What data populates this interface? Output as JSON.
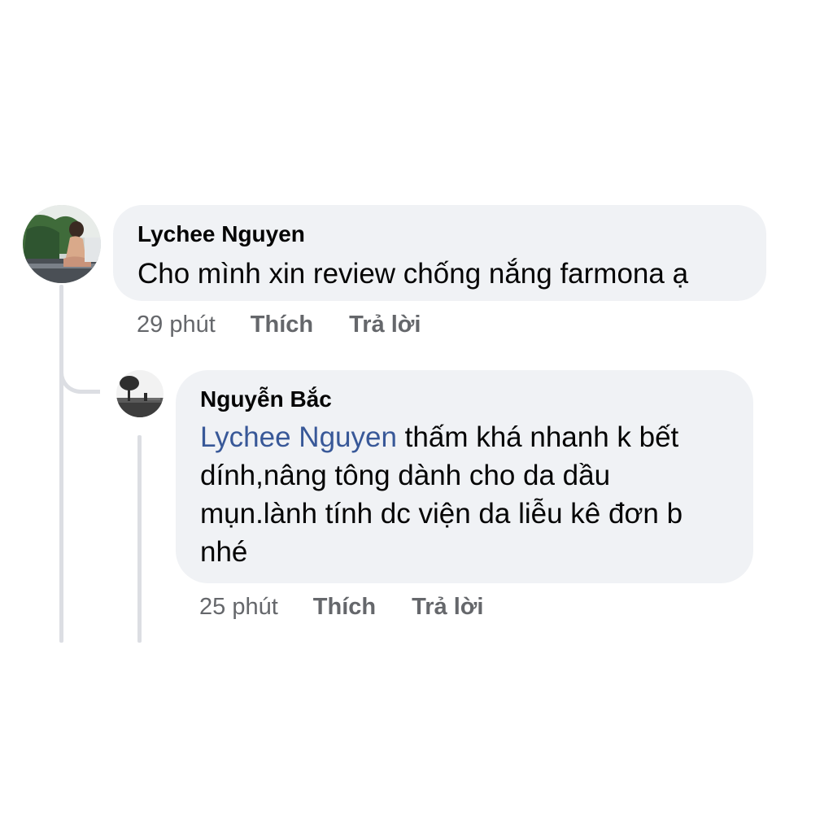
{
  "comments": [
    {
      "author": "Lychee Nguyen",
      "text": "Cho mình xin review chống nắng farmona ạ",
      "time": "29 phút",
      "like_label": "Thích",
      "reply_label": "Trả lời"
    }
  ],
  "reply": {
    "author": "Nguyễn Bắc",
    "mention": "Lychee Nguyen",
    "text": " thấm khá nhanh k bết dính,nâng tông dành cho da dầu mụn.lành tính dc viện da liễu kê đơn b nhé",
    "time": "25 phút",
    "like_label": "Thích",
    "reply_label": "Trả lời"
  },
  "colors": {
    "bubble": "#f0f2f5",
    "mention": "#385898",
    "meta": "#65676b",
    "thread_line": "#dcdee3"
  }
}
